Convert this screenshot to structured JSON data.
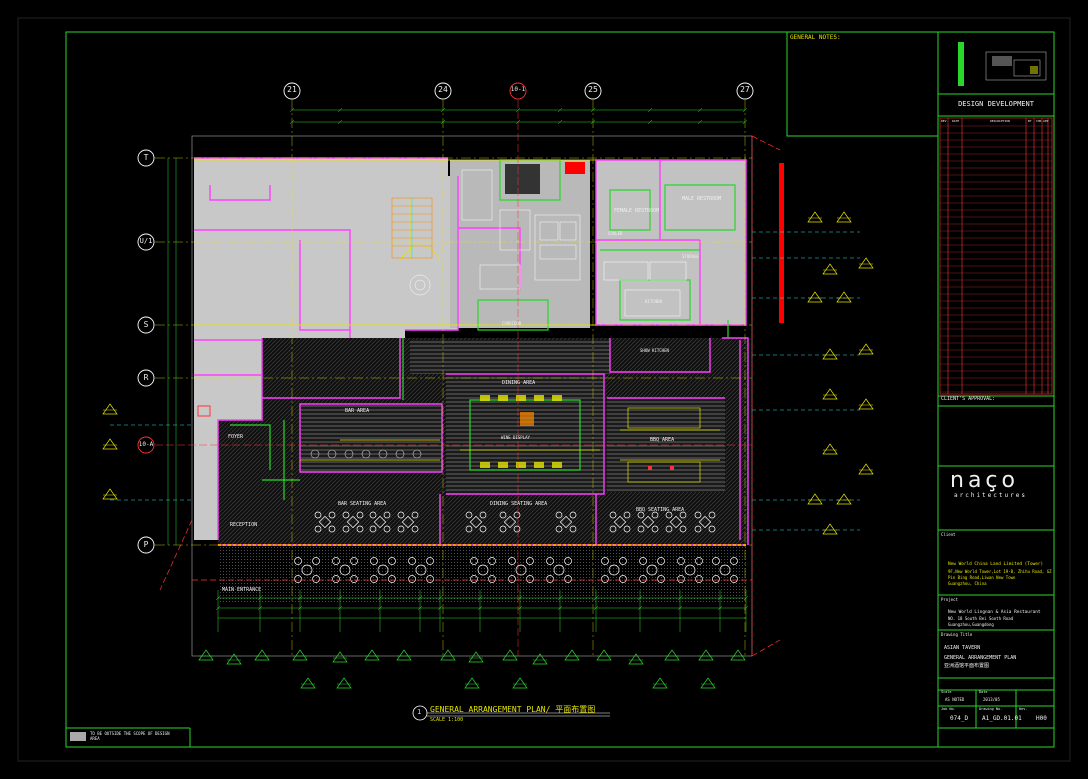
{
  "drawing": {
    "title": "GENERAL ARRANGEMENT PLAN/ 平面布置图",
    "title_number": "1",
    "scale": "SCALE 1:100",
    "legend_note": "TO BE OUTSIDE THE SCOPE OF DESIGN AREA"
  },
  "grid": {
    "columns": [
      "21",
      "24",
      "10-1",
      "25",
      "27"
    ],
    "rows": [
      "T",
      "U/1",
      "S",
      "R",
      "10-A",
      "P"
    ]
  },
  "rooms": {
    "female_restroom": "FEMALE RESTROOM",
    "male_restroom": "MALE RESTROOM",
    "bar_area": "BAR AREA",
    "dining_area": "DINING AREA",
    "foyer": "FOYER",
    "bbq_area": "BBQ AREA",
    "bar_seating_area": "BAR SEATING AREA",
    "dining_seating_area": "DINING SEATING AREA",
    "bbq_seating_area": "BBQ SEATING AREA",
    "reception": "RECEPTION",
    "main_entrance": "MAIN ENTRANCE",
    "corridor": "CORRIDOR",
    "kitchen": "KITCHEN",
    "show_kitchen": "SHOW KITCHEN",
    "storage": "STORAGE",
    "cooler": "COOLER",
    "wine_display": "WINE DISPLAY"
  },
  "title_block": {
    "general_notes_heading": "GENERAL NOTES:",
    "stage": "DESIGN DEVELOPMENT",
    "revision_headers": [
      "REV",
      "DATE",
      "DESCRIPTION",
      "BY",
      "CHK",
      "APP"
    ],
    "client_approval": "CLIENT'S APPROVAL:",
    "logo_main": "naço",
    "logo_sub": "architectures",
    "client_label": "Client",
    "client_name": "New World China Land Limited (Tower)",
    "client_address_1": "9F,New World Tower,Lot 19-B, Zhihu Road, GZ",
    "client_address_2": "Pin Bing Road,Liwan New Town",
    "client_address_3": "Guangzhou, China",
    "project_label": "Project",
    "project_name_1": "New World Lingnan & Asia Restaurant",
    "project_name_2": "NO. 18 South Bei Sooth Road",
    "project_name_3": "Guangzhou,Guangdong",
    "drawing_label": "Drawing Title",
    "drawing_title_1": "ASIAN TAVERN",
    "drawing_title_2": "GENERAL ARRANGEMENT PLAN",
    "drawing_title_3": "亚洲酒馆平面布置图",
    "scale_label": "Scale",
    "scale_value": "AS NOTED",
    "date_label": "Date",
    "date_value": "2013/05",
    "job_no_label": "Job No.",
    "job_no": "074_D",
    "drawing_no_label": "Drawing No.",
    "drawing_no": "A1_GD.01.01",
    "rev_label": "Rev.",
    "rev_value": "H00"
  },
  "colors": {
    "border": "#2bd62b",
    "floor": "#c8c8c8",
    "wall": "#ff40ff",
    "annotation": "#e6e600",
    "grid_line": "#ff3333"
  }
}
